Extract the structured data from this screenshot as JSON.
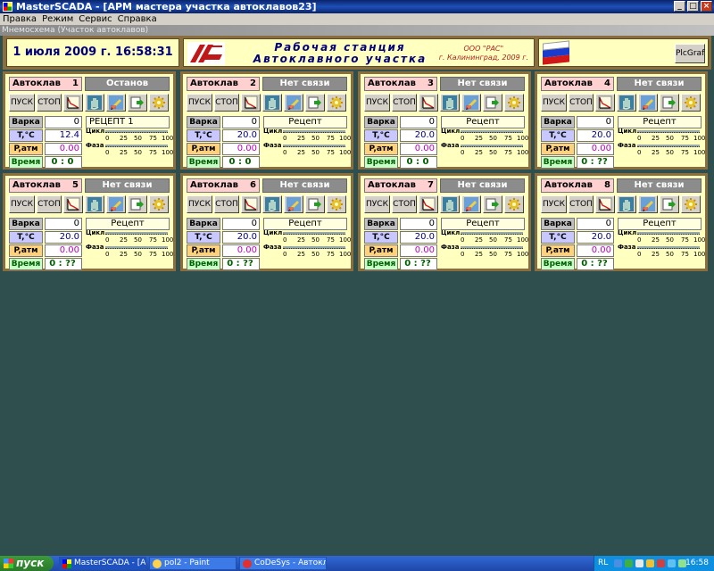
{
  "window": {
    "title": "MasterSCADA - [АРМ мастера участка автоклавов23]",
    "subwindow": "Мнемосхема (Участок автоклавов)"
  },
  "menu": [
    "Правка",
    "Режим",
    "Сервис",
    "Справка"
  ],
  "header": {
    "datetime": "1 июля 2009 г.  16:58:31",
    "title_line1": "Рабочая станция",
    "title_line2": "Автоклавного участка",
    "org_line1": "ООО \"РАС\"",
    "org_line2": "г. Калининград, 2009 г.",
    "plc_button": "PlcGraf"
  },
  "labels": {
    "autoclave": "Автоклав",
    "start": "ПУСК",
    "stop": "СТОП",
    "batch": "Варка",
    "temp": "T,°C",
    "pressure": "P,атм",
    "time": "Время",
    "cycle": "Цикл",
    "phase": "Фаза",
    "ticks": [
      "0",
      "25",
      "50",
      "75",
      "100"
    ]
  },
  "autoclaves": [
    {
      "num": "1",
      "state": "Останов",
      "batch": "0",
      "recipe": "РЕЦЕПТ 1",
      "temp": "12.4",
      "pressure": "0.00",
      "time": "0 :   0"
    },
    {
      "num": "2",
      "state": "Нет связи",
      "batch": "0",
      "recipe": "Рецепт",
      "temp": "20.0",
      "pressure": "0.00",
      "time": "0 :   0"
    },
    {
      "num": "3",
      "state": "Нет связи",
      "batch": "0",
      "recipe": "Рецепт",
      "temp": "20.0",
      "pressure": "0.00",
      "time": "0 :   0"
    },
    {
      "num": "4",
      "state": "Нет связи",
      "batch": "0",
      "recipe": "Рецепт",
      "temp": "20.0",
      "pressure": "0.00",
      "time": "0 : ??"
    },
    {
      "num": "5",
      "state": "Нет связи",
      "batch": "0",
      "recipe": "Рецепт",
      "temp": "20.0",
      "pressure": "0.00",
      "time": "0 : ??"
    },
    {
      "num": "6",
      "state": "Нет связи",
      "batch": "0",
      "recipe": "Рецепт",
      "temp": "20.0",
      "pressure": "0.00",
      "time": "0 : ??"
    },
    {
      "num": "7",
      "state": "Нет связи",
      "batch": "0",
      "recipe": "Рецепт",
      "temp": "20.0",
      "pressure": "0.00",
      "time": "0 : ??"
    },
    {
      "num": "8",
      "state": "Нет связи",
      "batch": "0",
      "recipe": "Рецепт",
      "temp": "20.0",
      "pressure": "0.00",
      "time": "0 : ??"
    }
  ],
  "taskbar": {
    "start": "пуск",
    "tasks": [
      "MasterSCADA - [АРМ...",
      "pol2 - Paint",
      "CoDeSys - Автоклав..."
    ],
    "lang": "RL",
    "clock": "16:58"
  },
  "colors": {
    "frame": "#8a6e3e",
    "panel_bg": "#ffffc0",
    "desktop": "#2f4f4f",
    "state_gray": "#8c8c8c"
  }
}
